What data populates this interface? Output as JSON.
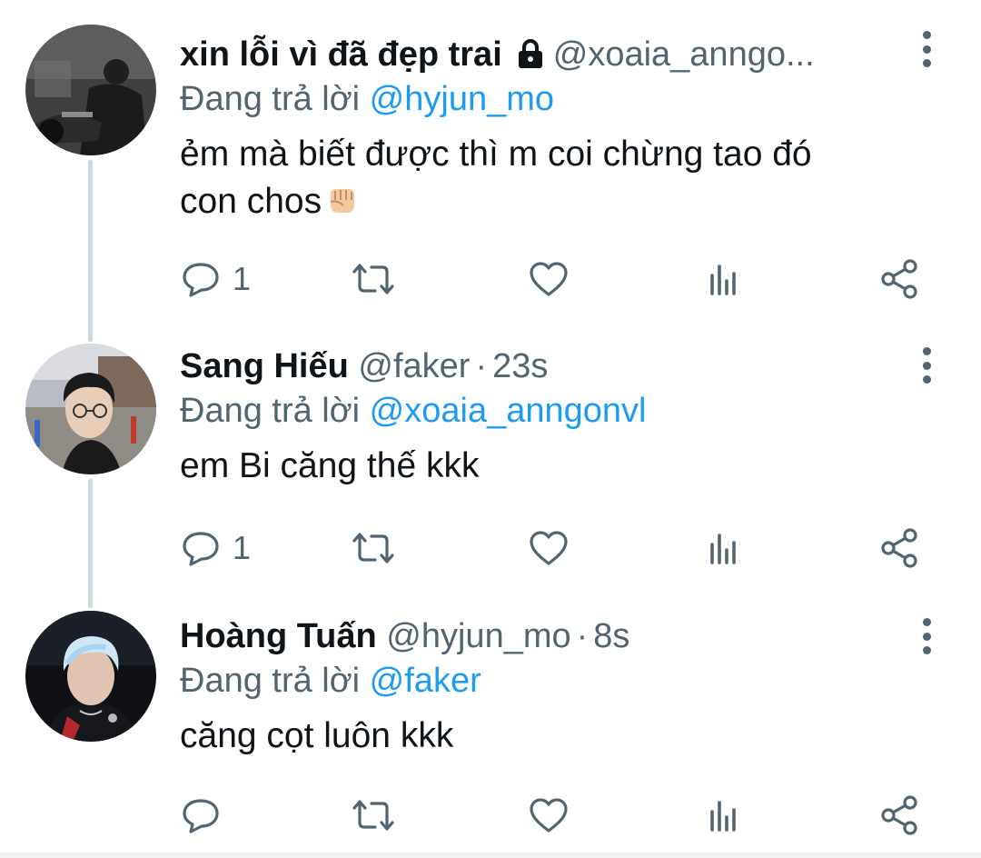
{
  "colors": {
    "text": "#0f1419",
    "secondary": "#536471",
    "mention": "#1d9bf0",
    "thread_line": "#cfd9de"
  },
  "tweets": [
    {
      "name": "xin lỗi vì đã đẹp trai",
      "protected_icon": "lock-icon",
      "handle": "@xoaia_anngo...",
      "time": "",
      "reply_prefix": "Đang trả lời",
      "reply_mention": "@hyjun_mo",
      "text_line1": "ẻm mà biết được thì m coi chừng tao đó",
      "text_line2": "con chos",
      "emoji": "fist-emoji",
      "reply_count": "1",
      "avatar": "motorcycle-rider-avatar"
    },
    {
      "name": "Sang Hiếu",
      "handle": "@faker",
      "time": "23s",
      "reply_prefix": "Đang trả lời",
      "reply_mention": "@xoaia_anngonvl",
      "text_line1": "em Bi căng thế kkk",
      "reply_count": "1",
      "avatar": "glasses-person-avatar"
    },
    {
      "name": "Hoàng Tuấn",
      "handle": "@hyjun_mo",
      "time": "8s",
      "reply_prefix": "Đang trả lời",
      "reply_mention": "@faker",
      "text_line1": "căng cọt luôn kkk",
      "reply_count": "",
      "avatar": "esports-player-avatar"
    }
  ],
  "icons": {
    "reply": "reply-icon",
    "retweet": "retweet-icon",
    "like": "heart-icon",
    "analytics": "analytics-icon",
    "share": "share-icon",
    "more": "more-vertical-icon"
  }
}
